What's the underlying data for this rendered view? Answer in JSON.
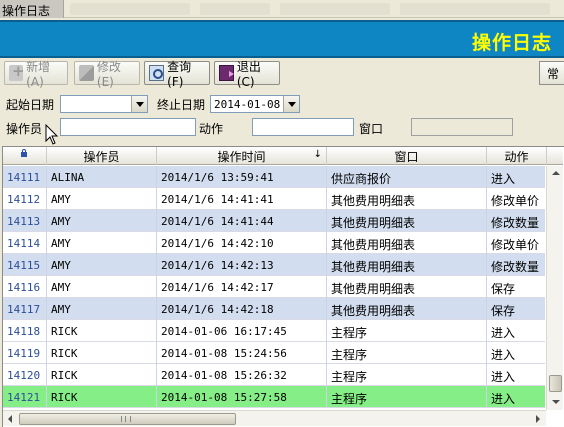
{
  "window": {
    "tab_title": "操作日志"
  },
  "banner": {
    "title": "操作日志"
  },
  "toolbar": {
    "add_label": "新增(A)",
    "edit_label": "修改(E)",
    "query_label": "查询(F)",
    "exit_label": "退出(C)",
    "right_button_label": "常"
  },
  "filters": {
    "start_date_label": "起始日期",
    "start_date_value": "",
    "end_date_label": "终止日期",
    "end_date_value": "2014-01-08",
    "operator_label": "操作员",
    "operator_value": "",
    "action_label": "动作",
    "action_value": "",
    "window_label": "窗口",
    "window_value": ""
  },
  "grid": {
    "headers": {
      "operator": "操作员",
      "time": "操作时间",
      "time_sort": "↓",
      "window": "窗口",
      "action": "动作"
    },
    "rows": [
      {
        "id": "14111",
        "operator": "ALINA",
        "time": "2014/1/6 13:59:41",
        "window": "供应商报价",
        "action": "进入"
      },
      {
        "id": "14112",
        "operator": "AMY",
        "time": "2014/1/6 14:41:41",
        "window": "其他费用明细表",
        "action": "修改单价"
      },
      {
        "id": "14113",
        "operator": "AMY",
        "time": "2014/1/6 14:41:44",
        "window": "其他费用明细表",
        "action": "修改数量"
      },
      {
        "id": "14114",
        "operator": "AMY",
        "time": "2014/1/6 14:42:10",
        "window": "其他费用明细表",
        "action": "修改单价"
      },
      {
        "id": "14115",
        "operator": "AMY",
        "time": "2014/1/6 14:42:13",
        "window": "其他费用明细表",
        "action": "修改数量"
      },
      {
        "id": "14116",
        "operator": "AMY",
        "time": "2014/1/6 14:42:17",
        "window": "其他费用明细表",
        "action": "保存"
      },
      {
        "id": "14117",
        "operator": "AMY",
        "time": "2014/1/6 14:42:18",
        "window": "其他费用明细表",
        "action": "保存"
      },
      {
        "id": "14118",
        "operator": "RICK",
        "time": "2014-01-06 16:17:45",
        "window": "主程序",
        "action": "进入"
      },
      {
        "id": "14119",
        "operator": "RICK",
        "time": "2014-01-08 15:24:56",
        "window": "主程序",
        "action": "进入"
      },
      {
        "id": "14120",
        "operator": "RICK",
        "time": "2014-01-08 15:26:32",
        "window": "主程序",
        "action": "进入"
      },
      {
        "id": "14121",
        "operator": "RICK",
        "time": "2014-01-08 15:27:58",
        "window": "主程序",
        "action": "进入"
      }
    ],
    "selected_row": 10
  },
  "colors": {
    "banner": "#0f86c4",
    "banner_text": "#ffff00",
    "row_alt": "#d2deef",
    "row_selected": "#86ee86",
    "id_text": "#2c4e9a"
  }
}
